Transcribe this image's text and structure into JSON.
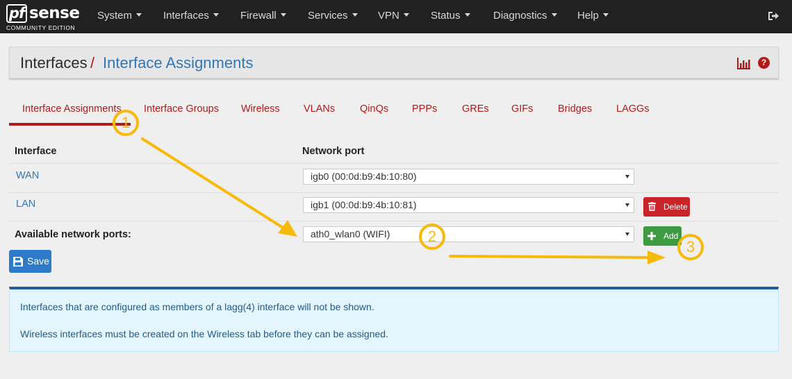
{
  "brand": {
    "logo_mark": "pf",
    "logo_word": "sense",
    "subtitle": "COMMUNITY EDITION"
  },
  "nav": {
    "items": [
      {
        "label": "System"
      },
      {
        "label": "Interfaces"
      },
      {
        "label": "Firewall"
      },
      {
        "label": "Services"
      },
      {
        "label": "VPN"
      },
      {
        "label": "Status"
      },
      {
        "label": "Diagnostics"
      },
      {
        "label": "Help"
      }
    ],
    "logout_icon": "sign-out-icon"
  },
  "breadcrumb": {
    "parent": "Interfaces",
    "separator": "/",
    "current": "Interface Assignments"
  },
  "header_icons": [
    "bar-chart-icon",
    "question-circle-icon"
  ],
  "tabs": [
    {
      "label": "Interface Assignments",
      "active": true
    },
    {
      "label": "Interface Groups"
    },
    {
      "label": "Wireless"
    },
    {
      "label": "VLANs"
    },
    {
      "label": "QinQs"
    },
    {
      "label": "PPPs"
    },
    {
      "label": "GREs"
    },
    {
      "label": "GIFs"
    },
    {
      "label": "Bridges"
    },
    {
      "label": "LAGGs"
    }
  ],
  "table": {
    "headers": {
      "interface": "Interface",
      "network_port": "Network port"
    },
    "rows": [
      {
        "interface": "WAN",
        "port": "igb0 (00:0d:b9:4b:10:80)"
      },
      {
        "interface": "LAN",
        "port": "igb1 (00:0d:b9:4b:10:81)",
        "action": "Delete"
      }
    ],
    "available": {
      "label": "Available network ports:",
      "port": "ath0_wlan0 (WIFI)",
      "action": "Add"
    }
  },
  "save_label": "Save",
  "info": {
    "line1": "Interfaces that are configured as members of a lagg(4) interface will not be shown.",
    "line2": "Wireless interfaces must be created on the Wireless tab before they can be assigned."
  },
  "annotations": {
    "step1": "1",
    "step2": "2",
    "step3": "3"
  },
  "colors": {
    "accent_red": "#b21a1a",
    "link_blue": "#3277b5",
    "annotation": "#f7b90a",
    "add_green": "#3e9a41",
    "delete_red": "#c9242a",
    "save_blue": "#2b7bc9"
  }
}
